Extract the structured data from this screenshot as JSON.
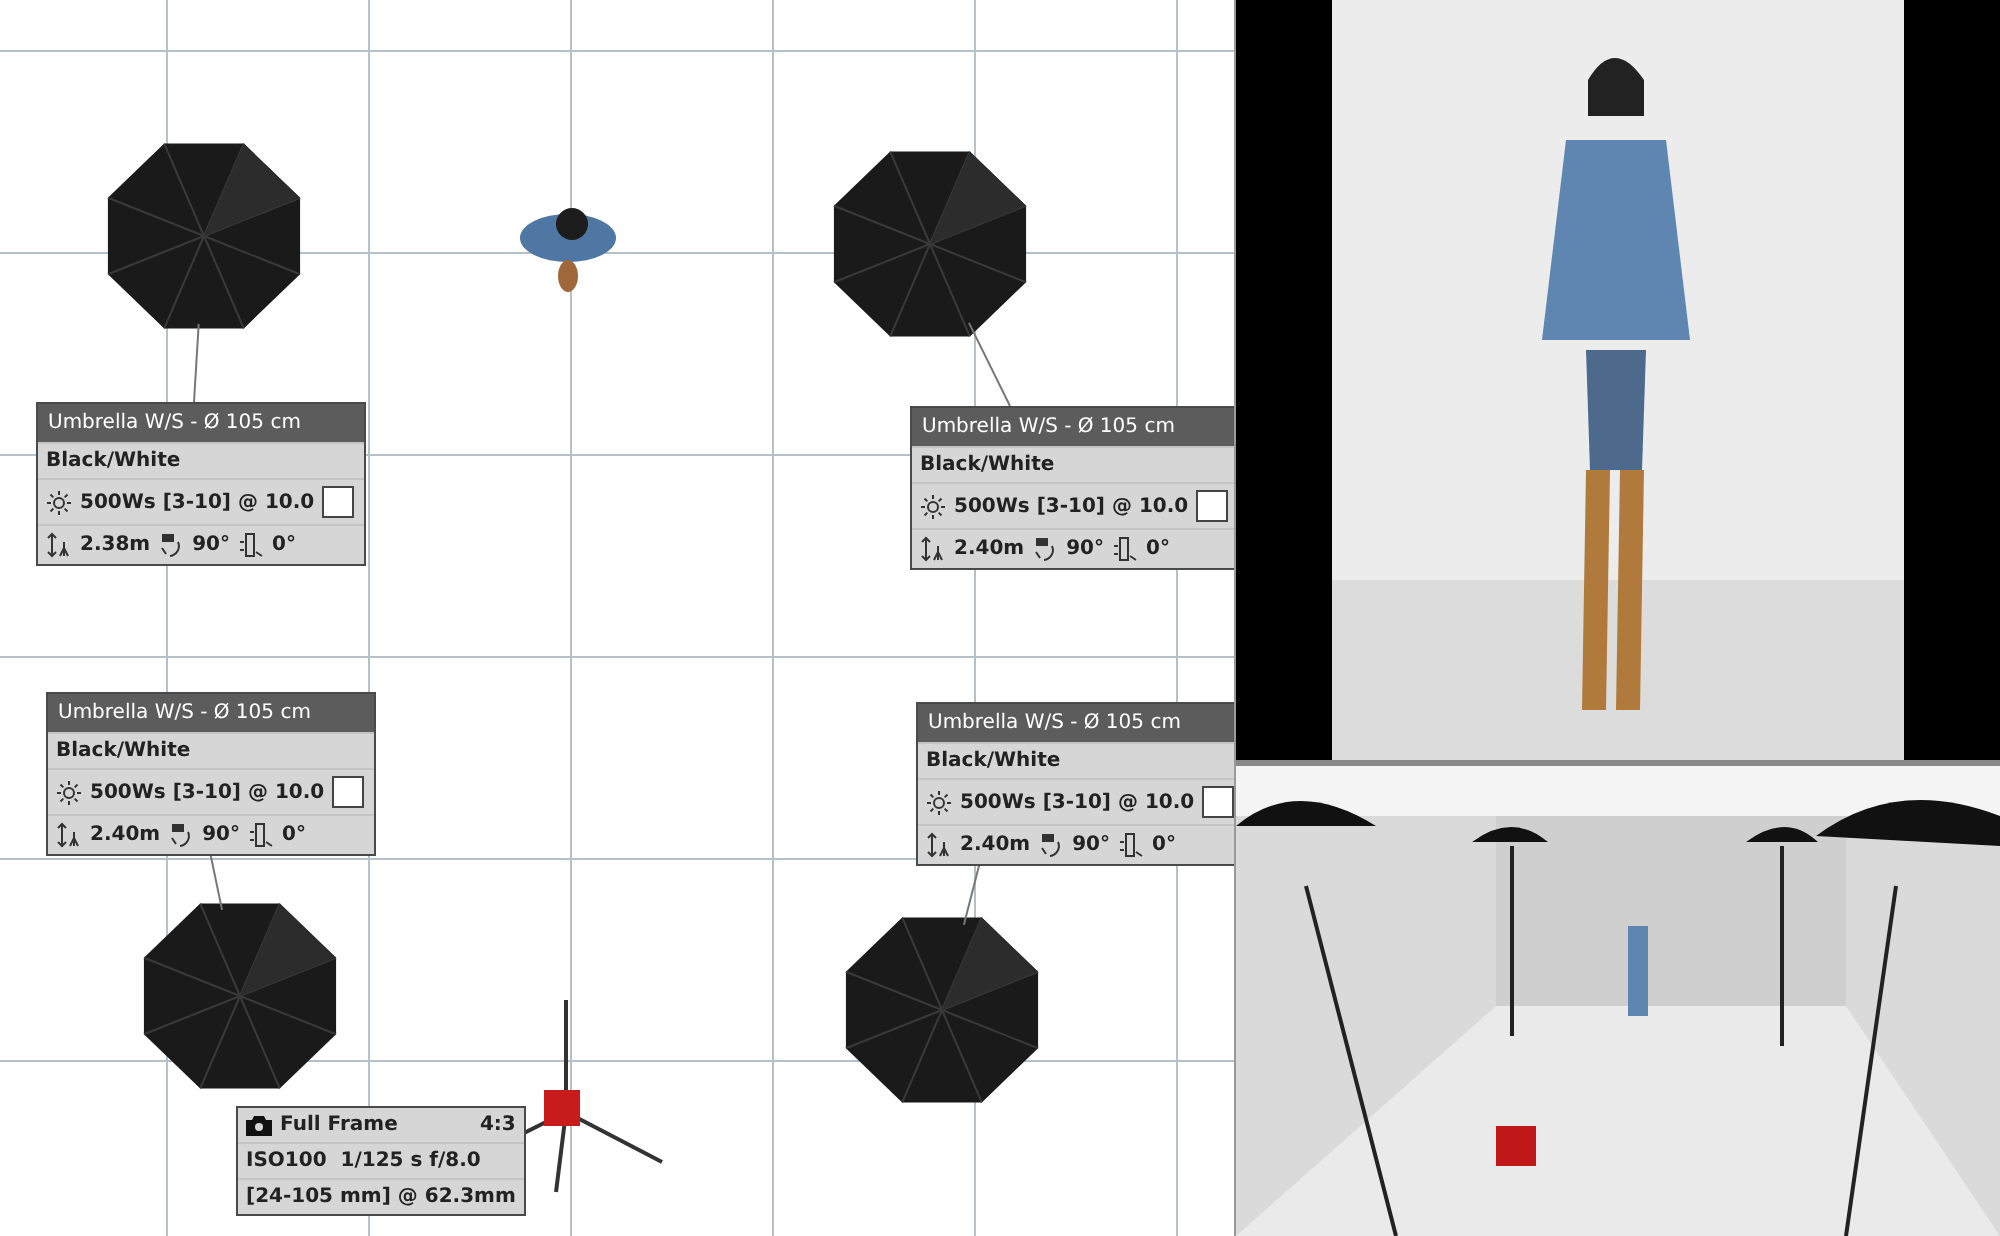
{
  "canvas": {
    "lights": [
      {
        "title": "Umbrella W/S - Ø 105 cm",
        "modifier": "Black/White",
        "power": "500Ws [3-10] @ 10.0",
        "height": "2.38m",
        "tilt": "90°",
        "rotation": "0°"
      },
      {
        "title": "Umbrella W/S - Ø 105 cm",
        "modifier": "Black/White",
        "power": "500Ws [3-10] @ 10.0",
        "height": "2.40m",
        "tilt": "90°",
        "rotation": "0°"
      },
      {
        "title": "Umbrella W/S - Ø 105 cm",
        "modifier": "Black/White",
        "power": "500Ws [3-10] @ 10.0",
        "height": "2.40m",
        "tilt": "90°",
        "rotation": "0°"
      },
      {
        "title": "Umbrella W/S - Ø 105 cm",
        "modifier": "Black/White",
        "power": "500Ws [3-10] @ 10.0",
        "height": "2.40m",
        "tilt": "90°",
        "rotation": "0°"
      }
    ],
    "camera": {
      "format": "Full Frame",
      "aspect": "4:3",
      "exposure": "ISO100  1/125 s f/8.0",
      "lens": "[24-105 mm] @ 62.3mm"
    }
  }
}
